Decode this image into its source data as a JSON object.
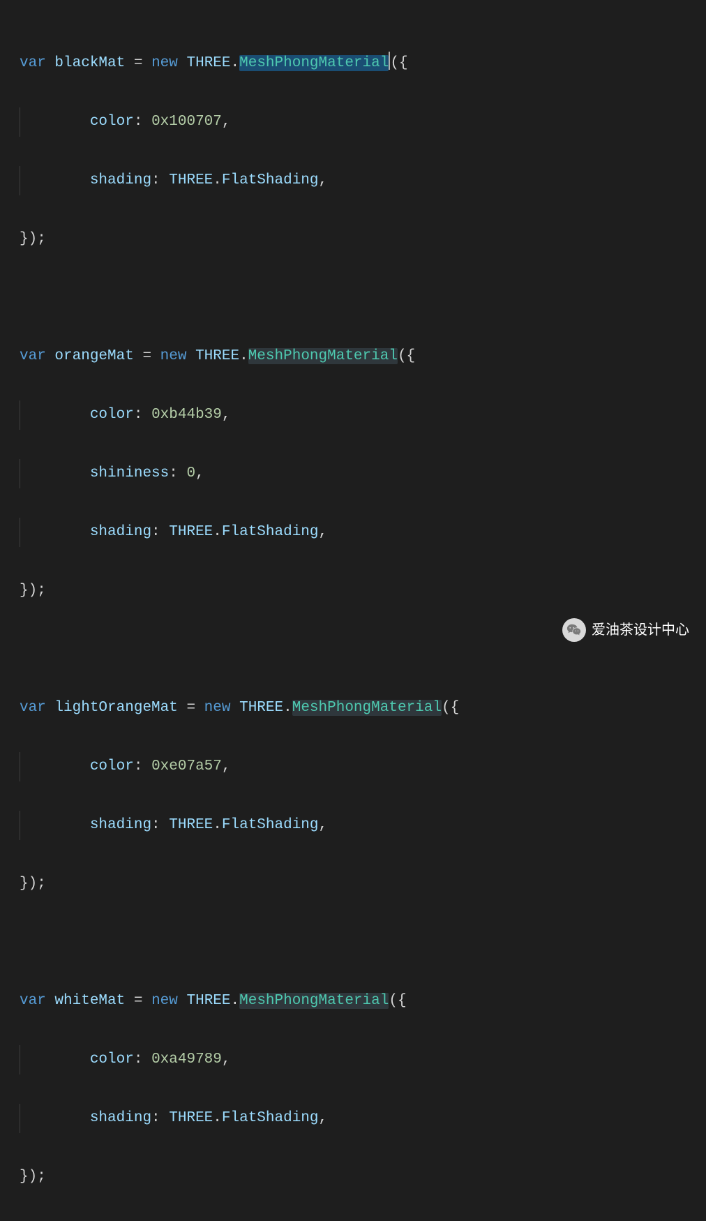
{
  "code": {
    "var": "var",
    "new": "new",
    "three": "THREE",
    "mesh": "MeshPhongMaterial",
    "block1": {
      "name": "blackMat",
      "color_key": "color",
      "color_val": "0x100707",
      "shading_key": "shading",
      "shading_val": "FlatShading"
    },
    "block2": {
      "name": "orangeMat",
      "color_key": "color",
      "color_val": "0xb44b39",
      "shininess_key": "shininess",
      "shininess_val": "0",
      "shading_key": "shading",
      "shading_val": "FlatShading"
    },
    "block3": {
      "name": "lightOrangeMat",
      "color_key": "color",
      "color_val": "0xe07a57",
      "shading_key": "shading",
      "shading_val": "FlatShading"
    },
    "block4": {
      "name": "whiteMat",
      "color_key": "color",
      "color_val": "0xa49789",
      "shading_key": "shading",
      "shading_val": "FlatShading"
    },
    "open": "({",
    "close": "});",
    "comma": ",",
    "colon": ": ",
    "dot": ".",
    "eq": " = "
  },
  "watermark": {
    "text": "爱油茶设计中心"
  }
}
